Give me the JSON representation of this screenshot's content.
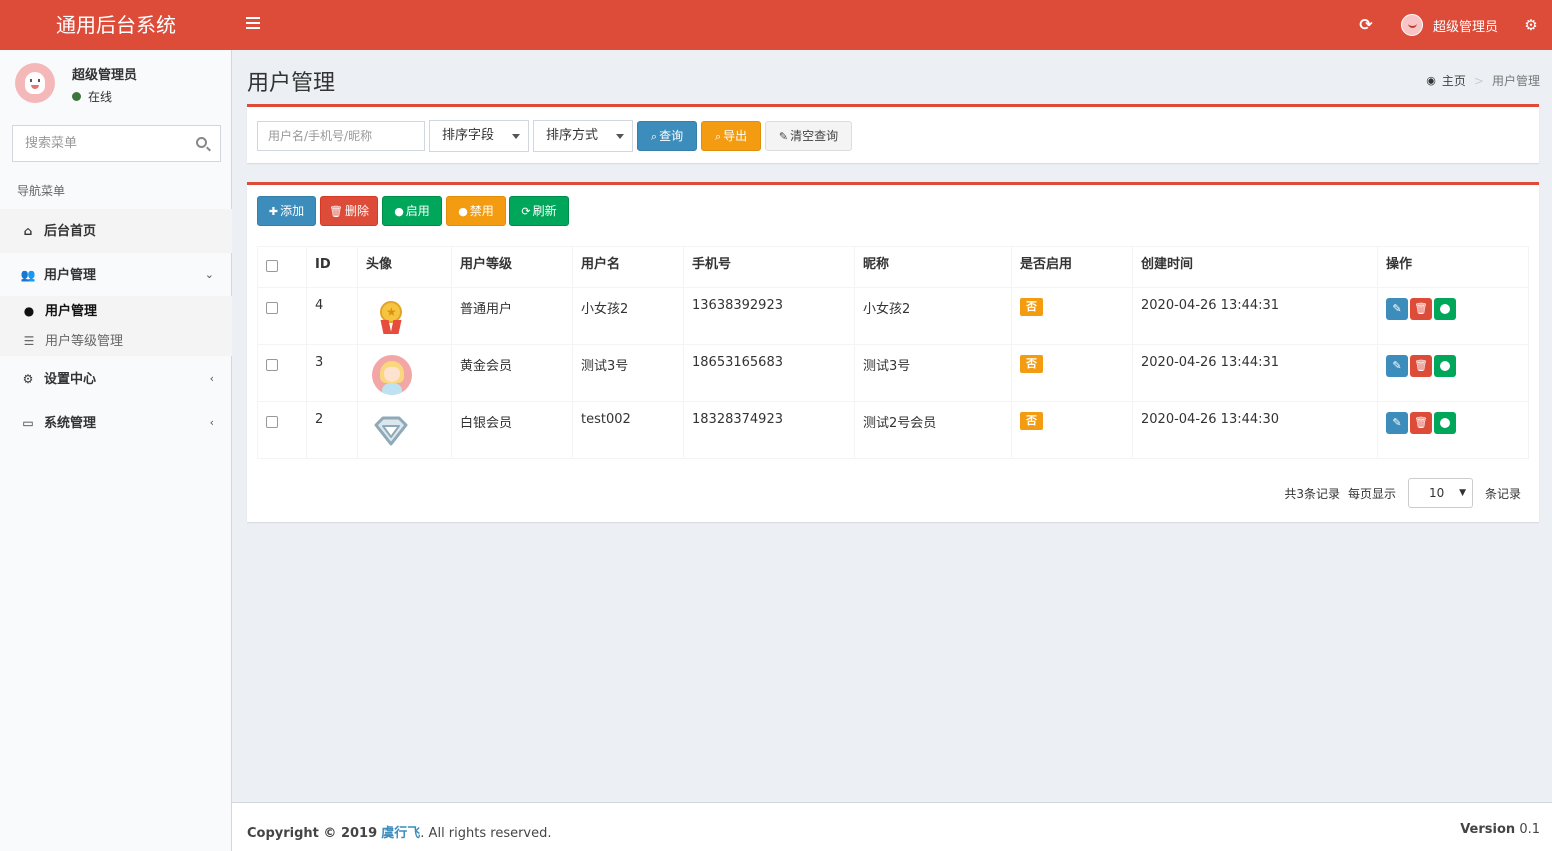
{
  "app": {
    "logo": "通用后台系统",
    "user_name": "超级管理员"
  },
  "sidebar": {
    "user_name": "超级管理员",
    "status": "在线",
    "search_placeholder": "搜索菜单",
    "nav_header": "导航菜单",
    "items": [
      {
        "label": "后台首页",
        "icon": "home-icon"
      },
      {
        "label": "用户管理",
        "icon": "users-icon",
        "chevron": "down"
      },
      {
        "label": "设置中心",
        "icon": "gears-icon",
        "chevron": "left"
      },
      {
        "label": "系统管理",
        "icon": "desktop-icon",
        "chevron": "left"
      }
    ],
    "sub_items": [
      {
        "label": "用户管理",
        "icon": "user-icon"
      },
      {
        "label": "用户等级管理",
        "icon": "list-icon"
      }
    ]
  },
  "header": {
    "title": "用户管理",
    "breadcrumb_home": "主页",
    "breadcrumb_current": "用户管理"
  },
  "search": {
    "keyword_placeholder": "用户名/手机号/昵称",
    "sort_field": "排序字段",
    "sort_order": "排序方式",
    "query_label": "查询",
    "export_label": "导出",
    "clear_label": "清空查询"
  },
  "toolbar": {
    "add_label": "添加",
    "delete_label": "删除",
    "enable_label": "启用",
    "disable_label": "禁用",
    "refresh_label": "刷新"
  },
  "table": {
    "columns": [
      "ID",
      "头像",
      "用户等级",
      "用户名",
      "手机号",
      "昵称",
      "是否启用",
      "创建时间",
      "操作"
    ],
    "rows": [
      {
        "id": "4",
        "avatar": "medal",
        "level": "普通用户",
        "username": "小女孩2",
        "phone": "13638392923",
        "nickname": "小女孩2",
        "enabled": "否",
        "created": "2020-04-26 13:44:31"
      },
      {
        "id": "3",
        "avatar": "girl",
        "level": "黄金会员",
        "username": "测试3号",
        "phone": "18653165683",
        "nickname": "测试3号",
        "enabled": "否",
        "created": "2020-04-26 13:44:31"
      },
      {
        "id": "2",
        "avatar": "diamond",
        "level": "白银会员",
        "username": "test002",
        "phone": "18328374923",
        "nickname": "测试2号会员",
        "enabled": "否",
        "created": "2020-04-26 13:44:30"
      }
    ]
  },
  "pager": {
    "total_text": "共3条记录",
    "per_page_text": "每页显示",
    "page_size": "10",
    "records_text": "条记录"
  },
  "footer": {
    "copyright_prefix": "Copyright © 2019",
    "author": "虞行飞",
    "rights": ". All rights reserved.",
    "version_label": "Version",
    "version_value": "0.1"
  },
  "colors": {
    "brand": "#dd4b39",
    "primary": "#3c8dbc",
    "warning": "#f39c12",
    "success": "#00a65a"
  }
}
